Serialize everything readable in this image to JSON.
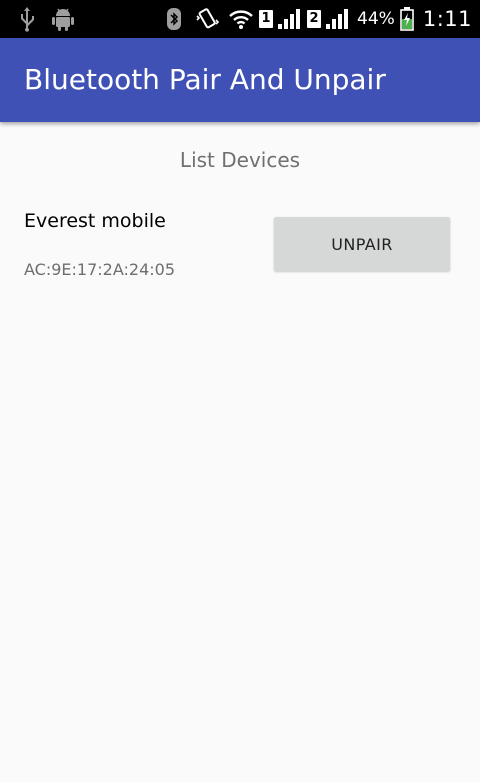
{
  "status_bar": {
    "sim1_label": "1",
    "sim2_label": "2",
    "battery_percent": "44%",
    "time": "1:11",
    "icons": [
      "usb-icon",
      "android-debug-icon",
      "bluetooth-icon",
      "vibrate-icon",
      "wifi-icon",
      "signal-icon",
      "signal-icon",
      "battery-charging-icon"
    ]
  },
  "app_bar": {
    "title": "Bluetooth Pair And Unpair",
    "color": "#3f51b5"
  },
  "main": {
    "list_header": "List Devices",
    "devices": [
      {
        "name": "Everest mobile",
        "address": "AC:9E:17:2A:24:05",
        "action_label": "UNPAIR"
      }
    ]
  }
}
